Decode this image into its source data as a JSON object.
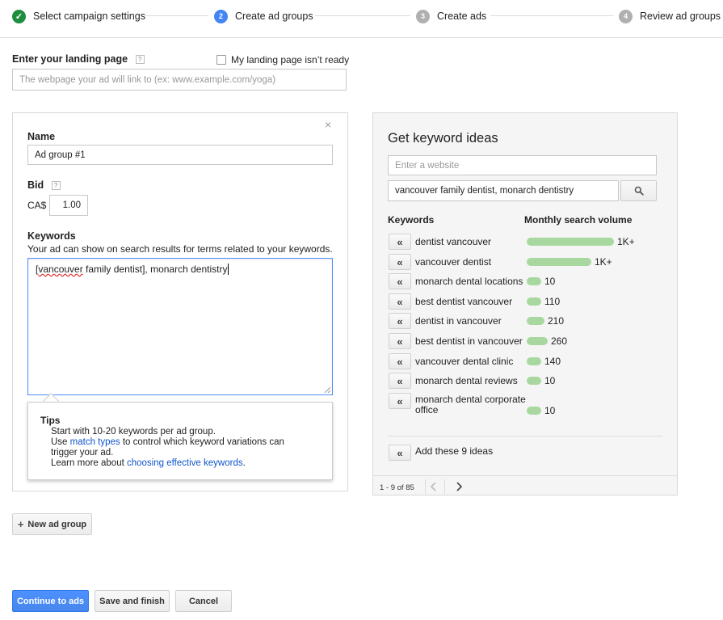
{
  "stepper": {
    "steps": [
      {
        "num": "",
        "label": "Select campaign settings",
        "state": "complete"
      },
      {
        "num": "2",
        "label": "Create ad groups",
        "state": "active"
      },
      {
        "num": "3",
        "label": "Create ads",
        "state": "upcoming"
      },
      {
        "num": "4",
        "label": "Review ad groups",
        "state": "upcoming"
      }
    ],
    "check_glyph": "✓"
  },
  "landing": {
    "label": "Enter your landing page",
    "help": "?",
    "not_ready_label": "My landing page isn’t ready",
    "not_ready_checked": false,
    "placeholder": "The webpage your ad will link to (ex: www.example.com/yoga)",
    "value": ""
  },
  "ad_group": {
    "close_glyph": "×",
    "name_label": "Name",
    "name_value": "Ad group #1",
    "bid_label": "Bid",
    "bid_help": "?",
    "currency": "CA$",
    "bid_value": "1.00",
    "keywords_label": "Keywords",
    "keywords_desc": "Your ad can show on search results for terms related to your keywords.",
    "keywords_bracket_open": "[",
    "keywords_misspelled": "vancouver",
    "keywords_rest": " family dentist], monarch dentistry",
    "tips": {
      "title": "Tips",
      "line1": "Start with 10-20 keywords per ad group.",
      "line2_pre": "Use ",
      "line2_link": "match types",
      "line2_post": " to control which keyword variations can",
      "line3": "trigger your ad.",
      "line4_pre": "Learn more about ",
      "line4_link": "choosing effective keywords",
      "line4_post": "."
    }
  },
  "ideas": {
    "title": "Get keyword ideas",
    "website_placeholder": "Enter a website",
    "search_value": "vancouver family dentist, monarch dentistry",
    "search_icon": "search-icon",
    "col_keywords": "Keywords",
    "col_volume": "Monthly search volume",
    "add_glyph": "«",
    "rows": [
      {
        "keyword": "dentist vancouver",
        "volume": "1K+",
        "level": 1.0
      },
      {
        "keyword": "vancouver dentist",
        "volume": "1K+",
        "level": 0.74
      },
      {
        "keyword": "monarch dental locations",
        "volume": "10",
        "level": 0.12
      },
      {
        "keyword": "best dentist vancouver",
        "volume": "110",
        "level": 0.15
      },
      {
        "keyword": "dentist in vancouver",
        "volume": "210",
        "level": 0.2
      },
      {
        "keyword": "best dentist in vancouver",
        "volume": "260",
        "level": 0.24
      },
      {
        "keyword": "vancouver dental clinic",
        "volume": "140",
        "level": 0.17
      },
      {
        "keyword": "monarch dental reviews",
        "volume": "10",
        "level": 0.12
      },
      {
        "keyword": "monarch dental corporate office",
        "volume": "10",
        "level": 0.12
      }
    ],
    "add_all_label": "Add these 9 ideas",
    "pagination": "1 - 9 of 85",
    "prev_icon": "chevron-left-icon",
    "next_icon": "chevron-right-icon"
  },
  "actions": {
    "new_ad_group_plus": "+",
    "new_ad_group_label": "New ad group",
    "continue_label": "Continue to ads",
    "save_label": "Save and finish",
    "cancel_label": "Cancel"
  },
  "colors": {
    "primary": "#4d90fe",
    "success": "#1e8e3e",
    "volume_bar": "#a8d8a0",
    "link": "#1155cc"
  }
}
